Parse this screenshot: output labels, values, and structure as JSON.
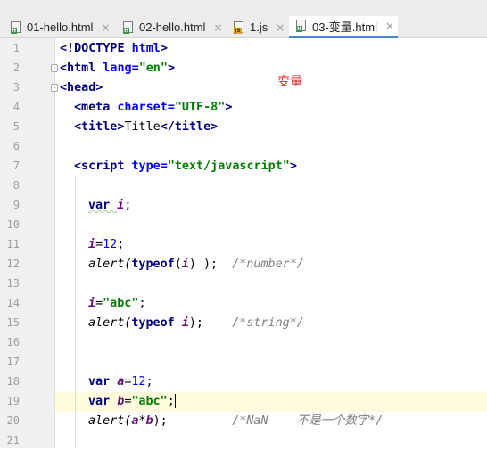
{
  "tabs": [
    {
      "label": "01-hello.html",
      "icon": "html-file-icon",
      "badge": "H",
      "active": false
    },
    {
      "label": "02-hello.html",
      "icon": "html-file-icon",
      "badge": "H",
      "active": false
    },
    {
      "label": "1.js",
      "icon": "js-file-icon",
      "badge": "JS",
      "active": false
    },
    {
      "label": "03-变量.html",
      "icon": "html-file-icon",
      "badge": "H",
      "active": true
    }
  ],
  "close_glyph": "×",
  "annotation": "变量",
  "line_numbers": [
    "1",
    "2",
    "3",
    "4",
    "5",
    "6",
    "7",
    "8",
    "9",
    "10",
    "11",
    "12",
    "13",
    "14",
    "15",
    "16",
    "17",
    "18",
    "19",
    "20",
    "21"
  ],
  "code": {
    "l1": {
      "a": "<!DOCTYPE ",
      "b": "html",
      "c": ">"
    },
    "l2": {
      "a": "<html ",
      "b": "lang",
      "c": "=",
      "d": "\"en\"",
      "e": ">"
    },
    "l3": {
      "a": "<head>"
    },
    "l4": {
      "a": "<meta ",
      "b": "charset",
      "c": "=",
      "d": "\"UTF-8\"",
      "e": ">"
    },
    "l5": {
      "a": "<title>",
      "b": "Title",
      "c": "</title>"
    },
    "l7": {
      "a": "<script ",
      "b": "type",
      "c": "=",
      "d": "\"text/javascript\"",
      "e": ">"
    },
    "l9": {
      "a": "var ",
      "b": "i",
      "c": ";"
    },
    "l11": {
      "a": "i",
      "b": "=",
      "c": "12",
      "d": ";"
    },
    "l12": {
      "a": "alert(",
      "b": "typeof",
      "c": "(",
      "d": "i",
      "e": ") );  ",
      "f": "/*number*/"
    },
    "l14": {
      "a": "i",
      "b": "=",
      "c": "\"abc\"",
      "d": ";"
    },
    "l15": {
      "a": "alert(",
      "b": "typeof ",
      "c": "i",
      "d": ");    ",
      "e": "/*string*/"
    },
    "l18": {
      "a": "var ",
      "b": "a",
      "c": "=",
      "d": "12",
      "e": ";"
    },
    "l19": {
      "a": "var ",
      "b": "b",
      "c": "=",
      "d": "\"abc\"",
      "e": ";"
    },
    "l20": {
      "a": "alert(",
      "b": "a",
      "c": "*",
      "d": "b",
      "e": ");         ",
      "f": "/*NaN    不是一个数字*/"
    }
  }
}
